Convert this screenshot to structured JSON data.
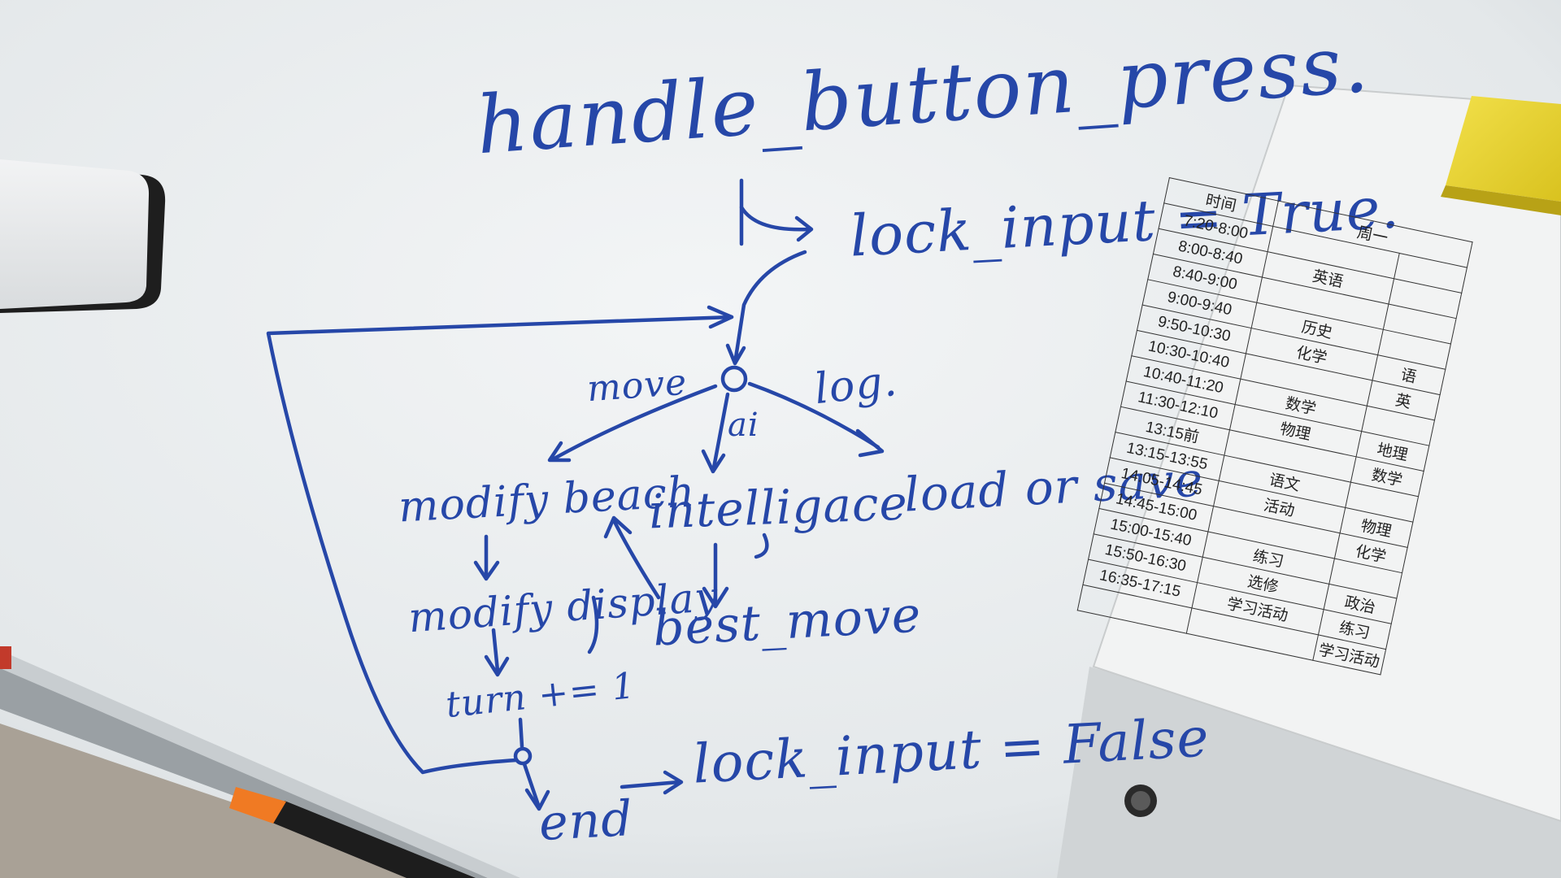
{
  "whiteboard": {
    "title": "handle_button_press.",
    "lock_true": "lock_input = True.",
    "labels": {
      "move": "move",
      "log": "log.",
      "ai": "ai"
    },
    "nodes": {
      "modify_board": "modify beach",
      "intelligence": "intelligace",
      "load_or_save": "load or save",
      "modify_display": "modify display",
      "best_move": "best_move",
      "turn": "turn += 1",
      "lock_false": "lock_input = False",
      "end": "end"
    },
    "ink_color": "#2647a8"
  },
  "schedule": {
    "headers": [
      "时间",
      "周一"
    ],
    "rows": [
      {
        "time": "7:20-8:00",
        "c1": "",
        "c2": ""
      },
      {
        "time": "8:00-8:40",
        "c1": "英语",
        "c2": ""
      },
      {
        "time": "8:40-9:00",
        "c1": "",
        "c2": ""
      },
      {
        "time": "9:00-9:40",
        "c1": "历史",
        "c2": ""
      },
      {
        "time": "9:50-10:30",
        "c1": "化学",
        "c2": "语"
      },
      {
        "time": "10:30-10:40",
        "c1": "",
        "c2": "英"
      },
      {
        "time": "10:40-11:20",
        "c1": "数学",
        "c2": ""
      },
      {
        "time": "11:30-12:10",
        "c1": "物理",
        "c2": "地理"
      },
      {
        "time": "13:15前",
        "c1": "",
        "c2": "数学"
      },
      {
        "time": "13:15-13:55",
        "c1": "语文",
        "c2": ""
      },
      {
        "time": "14:05-14:45",
        "c1": "活动",
        "c2": "物理"
      },
      {
        "time": "14:45-15:00",
        "c1": "",
        "c2": "化学"
      },
      {
        "time": "15:00-15:40",
        "c1": "练习",
        "c2": ""
      },
      {
        "time": "15:50-16:30",
        "c1": "选修",
        "c2": "政治"
      },
      {
        "time": "16:35-17:15",
        "c1": "学习活动",
        "c2": "练习"
      },
      {
        "time": "",
        "c1": "",
        "c2": "学习活动"
      }
    ]
  }
}
